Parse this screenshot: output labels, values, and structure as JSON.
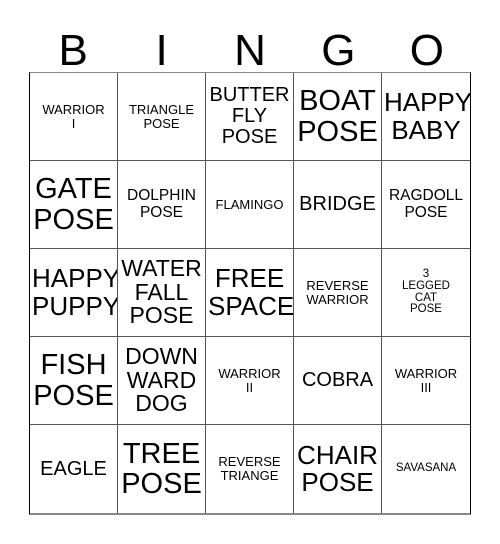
{
  "card": {
    "title_letters": [
      "B",
      "I",
      "N",
      "G",
      "O"
    ],
    "rows": [
      [
        {
          "text": "WARRIOR\nI",
          "size": "s-xs"
        },
        {
          "text": "TRIANGLE\nPOSE",
          "size": "s-xs"
        },
        {
          "text": "BUTTER\nFLY\nPOSE",
          "size": "s-md"
        },
        {
          "text": "BOAT\nPOSE",
          "size": "s-xxl"
        },
        {
          "text": "HAPPY\nBABY",
          "size": "s-xl"
        }
      ],
      [
        {
          "text": "GATE\nPOSE",
          "size": "s-xxl"
        },
        {
          "text": "DOLPHIN\nPOSE",
          "size": "s-sm"
        },
        {
          "text": "FLAMINGO",
          "size": "s-xs"
        },
        {
          "text": "BRIDGE",
          "size": "s-md"
        },
        {
          "text": "RAGDOLL\nPOSE",
          "size": "s-sm"
        }
      ],
      [
        {
          "text": "HAPPY\nPUPPY",
          "size": "s-xl"
        },
        {
          "text": "WATER\nFALL\nPOSE",
          "size": "s-lg"
        },
        {
          "text": "FREE\nSPACE",
          "size": "s-xl"
        },
        {
          "text": "REVERSE\nWARRIOR",
          "size": "s-xs"
        },
        {
          "text": "3\nLEGGED\nCAT\nPOSE",
          "size": "s-xxs"
        }
      ],
      [
        {
          "text": "FISH\nPOSE",
          "size": "s-xxl"
        },
        {
          "text": "DOWN\nWARD\nDOG",
          "size": "s-lg"
        },
        {
          "text": "WARRIOR\nII",
          "size": "s-xs"
        },
        {
          "text": "COBRA",
          "size": "s-md"
        },
        {
          "text": "WARRIOR\nIII",
          "size": "s-xs"
        }
      ],
      [
        {
          "text": "EAGLE",
          "size": "s-md"
        },
        {
          "text": "TREE\nPOSE",
          "size": "s-xxl"
        },
        {
          "text": "REVERSE\nTRIANGE",
          "size": "s-xs"
        },
        {
          "text": "CHAIR\nPOSE",
          "size": "s-xl"
        },
        {
          "text": "SAVASANA",
          "size": "s-xxs"
        }
      ]
    ]
  },
  "colors": {
    "background": "#ffffff",
    "text": "#000000",
    "grid_line": "#555555",
    "outer_border": "#000000"
  }
}
